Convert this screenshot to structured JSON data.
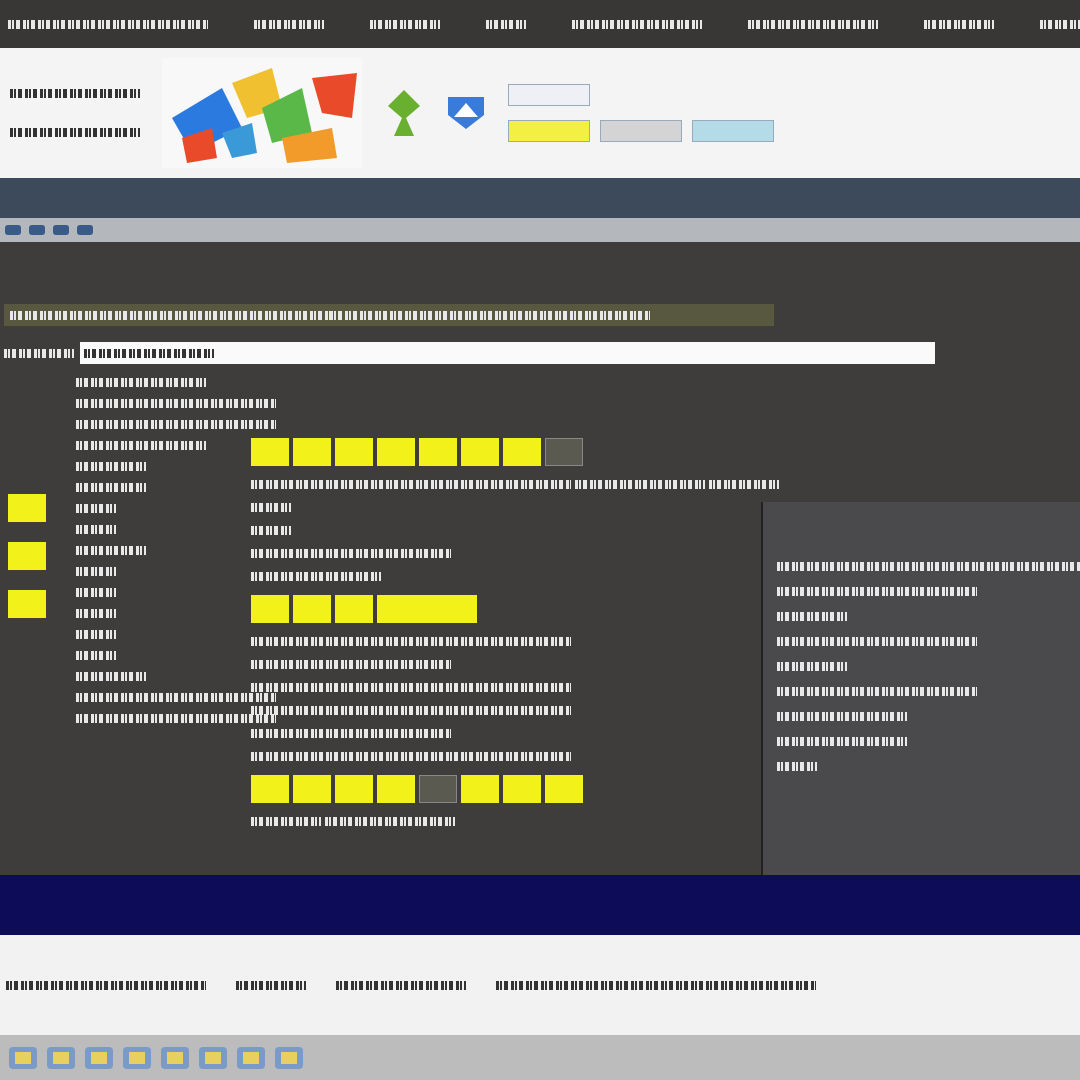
{
  "ribbon": {
    "chips": [
      {
        "color": "#eef0f6"
      },
      {
        "color": "#f2f040"
      },
      {
        "color": "#d4d4d4"
      },
      {
        "color": "#b4dce8"
      }
    ]
  },
  "main": {
    "side_blocks": [
      {
        "highlighted": true
      },
      {
        "highlighted": true
      },
      {
        "highlighted": true
      }
    ],
    "top_blocks": [
      {
        "highlighted": true
      },
      {
        "highlighted": true
      },
      {
        "highlighted": true
      },
      {
        "highlighted": true
      },
      {
        "highlighted": true
      },
      {
        "highlighted": true
      },
      {
        "highlighted": true
      },
      {
        "highlighted": false
      }
    ],
    "mid_blocks": [
      {
        "highlighted": true
      },
      {
        "highlighted": true
      },
      {
        "highlighted": true
      },
      {
        "highlighted": true
      }
    ],
    "bottom_blocks": [
      {
        "highlighted": true
      },
      {
        "highlighted": true
      },
      {
        "highlighted": true
      },
      {
        "highlighted": true
      },
      {
        "highlighted": false
      },
      {
        "highlighted": true
      },
      {
        "highlighted": true
      },
      {
        "highlighted": true
      }
    ]
  }
}
